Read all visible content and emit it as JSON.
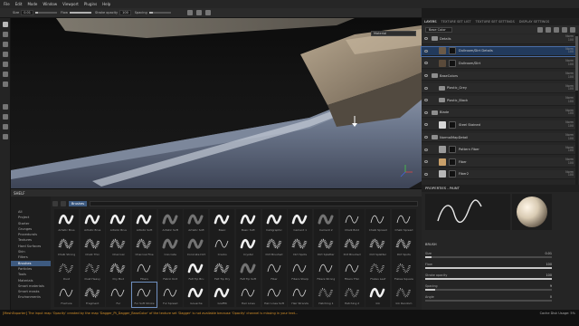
{
  "menu": [
    "File",
    "Edit",
    "Mode",
    "Window",
    "Viewport",
    "Plugins",
    "Help"
  ],
  "toolbar": {
    "size_label": "Size",
    "size_value": "0.01",
    "flow_label": "Flow",
    "stroke_opacity_label": "Stroke opacity",
    "stroke_opacity_value": "100",
    "spacing_label": "Spacing"
  },
  "viewport": {
    "mode_select": "Material"
  },
  "shelf": {
    "title": "SHELF",
    "filter_chip": "Brushes",
    "categories": [
      {
        "label": "All",
        "active": false
      },
      {
        "label": "Project",
        "active": false
      },
      {
        "label": "Starter",
        "active": false
      },
      {
        "label": "Grunges",
        "active": false
      },
      {
        "label": "Procedurals",
        "active": false
      },
      {
        "label": "Textures",
        "active": false
      },
      {
        "label": "Hard Surfaces",
        "active": false
      },
      {
        "label": "Skin",
        "active": false
      },
      {
        "label": "Filters",
        "active": false
      },
      {
        "label": "Brushes",
        "active": true
      },
      {
        "label": "Particles",
        "active": false
      },
      {
        "label": "Tools",
        "active": false
      },
      {
        "label": "Materials",
        "active": false
      },
      {
        "label": "Smart materials",
        "active": false
      },
      {
        "label": "Smart masks",
        "active": false
      },
      {
        "label": "Environments",
        "active": false
      }
    ],
    "brushes": [
      {
        "label": "Artistic Brus",
        "style": "wave"
      },
      {
        "label": "Artistic Brus",
        "style": "wave"
      },
      {
        "label": "Artistic Brus",
        "style": "wave"
      },
      {
        "label": "Artistic Soft",
        "style": "wave"
      },
      {
        "label": "Artistic Soft",
        "style": "soft"
      },
      {
        "label": "Artistic Soft",
        "style": "soft"
      },
      {
        "label": "Basic",
        "style": "wave"
      },
      {
        "label": "Basic Soft",
        "style": "wave"
      },
      {
        "label": "Calligraphic",
        "style": "wave"
      },
      {
        "label": "Cement 1",
        "style": "wave"
      },
      {
        "label": "Cement 2",
        "style": "soft"
      },
      {
        "label": "Chalk Bold",
        "style": "thin"
      },
      {
        "label": "Chalk Spread",
        "style": "thin"
      },
      {
        "label": "Chalk Spread",
        "style": "thin"
      },
      {
        "label": "Chalk Strong",
        "style": "grain"
      },
      {
        "label": "Chalk Thin",
        "style": "grain"
      },
      {
        "label": "Charcoal",
        "style": "grain"
      },
      {
        "label": "Charcoal Fine",
        "style": "grain"
      },
      {
        "label": "Concrete",
        "style": "soft"
      },
      {
        "label": "Concrete Dirt",
        "style": "soft"
      },
      {
        "label": "Cracks",
        "style": "thin"
      },
      {
        "label": "Crystal",
        "style": "wave"
      },
      {
        "label": "Dirt Brushed",
        "style": "grain"
      },
      {
        "label": "Dirt Spots",
        "style": "grain"
      },
      {
        "label": "Dirt Splatter",
        "style": "grain"
      },
      {
        "label": "Dirt Brushed",
        "style": "grain"
      },
      {
        "label": "Dirt Splatter",
        "style": "grain"
      },
      {
        "label": "Dirt Spots",
        "style": "grain"
      },
      {
        "label": "Dust",
        "style": "dots"
      },
      {
        "label": "Dust Heavy",
        "style": "dots"
      },
      {
        "label": "Dry Mud",
        "style": "grain"
      },
      {
        "label": "Fibers",
        "style": "thin"
      },
      {
        "label": "Fabric Knit",
        "style": "grain"
      },
      {
        "label": "Felt Tip Bru",
        "style": "wave"
      },
      {
        "label": "Felt Tip Dry",
        "style": "grain"
      },
      {
        "label": "Felt Tip Soft",
        "style": "soft"
      },
      {
        "label": "Fiber",
        "style": "thin"
      },
      {
        "label": "Fibers Sharp",
        "style": "thin"
      },
      {
        "label": "Fibers Strong",
        "style": "thin"
      },
      {
        "label": "Fibers Thin",
        "style": "thin"
      },
      {
        "label": "Flakes Leaf",
        "style": "dots"
      },
      {
        "label": "Flakes Square",
        "style": "dots"
      },
      {
        "label": "Fracture",
        "style": "thin"
      },
      {
        "label": "Fragment",
        "style": "grain"
      },
      {
        "label": "Fur",
        "style": "thin"
      },
      {
        "label": "Fur Soft Stroke",
        "style": "thin"
      },
      {
        "label": "Fur Spread",
        "style": "thin"
      },
      {
        "label": "Gouache",
        "style": "wave"
      },
      {
        "label": "Graffiti",
        "style": "wave"
      },
      {
        "label": "Hair Lines",
        "style": "thin"
      },
      {
        "label": "Hair Lines Soft",
        "style": "thin"
      },
      {
        "label": "Hair Strands",
        "style": "thin"
      },
      {
        "label": "Hatching 1",
        "style": "dots"
      },
      {
        "label": "Hatching 2",
        "style": "dots"
      },
      {
        "label": "Ink",
        "style": "wave"
      },
      {
        "label": "Ink Random",
        "style": "dots"
      }
    ]
  },
  "panel_tabs": [
    "LAYERS",
    "TEXTURE SET LIST",
    "TEXTURE SET SETTINGS",
    "DISPLAY SETTINGS"
  ],
  "layers_toolbar": {
    "channel_select": "Base Color"
  },
  "layers": [
    {
      "name": "Details",
      "blend": "Norm",
      "opacity": "100",
      "type": "folder",
      "color": "#8e8e8e",
      "indent": 0,
      "selected": false
    },
    {
      "name": "Dullroom/Dirt Details",
      "blend": "Norm",
      "opacity": "100",
      "type": "fill",
      "color": "#6b5a48",
      "indent": 1,
      "selected": true
    },
    {
      "name": "Dullroom/Dirt",
      "blend": "Norm",
      "opacity": "100",
      "type": "fill",
      "color": "#5a4a3a",
      "indent": 1,
      "selected": false
    },
    {
      "name": "BaseColors",
      "blend": "Norm",
      "opacity": "100",
      "type": "folder",
      "color": "#8e8e8e",
      "indent": 0,
      "selected": false
    },
    {
      "name": "Plastic_Grey",
      "blend": "Norm",
      "opacity": "100",
      "type": "folder",
      "color": "#8e8e8e",
      "indent": 1,
      "selected": false
    },
    {
      "name": "Plastic_Black",
      "blend": "Norm",
      "opacity": "100",
      "type": "folder",
      "color": "#8e8e8e",
      "indent": 1,
      "selected": false
    },
    {
      "name": "Blade",
      "blend": "Norm",
      "opacity": "100",
      "type": "folder",
      "color": "#8e8e8e",
      "indent": 0,
      "selected": false
    },
    {
      "name": "Steel Stained",
      "blend": "Norm",
      "opacity": "100",
      "type": "fill",
      "color": "#d7d7d7",
      "indent": 1,
      "selected": false
    },
    {
      "name": "NormalMapDetail",
      "blend": "Norm",
      "opacity": "100",
      "type": "folder",
      "color": "#8e8e8e",
      "indent": 0,
      "selected": false
    },
    {
      "name": "Pattern Fiber",
      "blend": "Norm",
      "opacity": "100",
      "type": "fill",
      "color": "#9b9b9b",
      "indent": 1,
      "selected": false
    },
    {
      "name": "Fiber",
      "blend": "Norm",
      "opacity": "100",
      "type": "fill",
      "color": "#c9a06a",
      "indent": 1,
      "selected": false
    },
    {
      "name": "Fiber2",
      "blend": "Norm",
      "opacity": "100",
      "type": "fill",
      "color": "#b8b8b8",
      "indent": 1,
      "selected": false
    }
  ],
  "properties": {
    "title": "PROPERTIES - PAINT",
    "brush_section": "BRUSH",
    "rows": [
      {
        "label": "Size",
        "value": "0.01",
        "fill": 0.05
      },
      {
        "label": "Flow",
        "value": "100",
        "fill": 1.0
      },
      {
        "label": "Stroke opacity",
        "value": "100",
        "fill": 1.0
      },
      {
        "label": "Spacing",
        "value": "9",
        "fill": 0.08
      },
      {
        "label": "Angle",
        "value": "0",
        "fill": 0.0
      }
    ]
  },
  "status": {
    "message": "[MeshExporter] The input map 'Opacity' created by the map 'Dagger_Pt_Dagger_BaseColor' of the texture set 'Dagger' is not available because 'Opacity' channel is missing in your text...",
    "right": "Cache Disk Usage: 5%"
  },
  "colors": {
    "accent": "#3d5a80",
    "selection": "#223a5c",
    "warning": "#d8922a"
  }
}
